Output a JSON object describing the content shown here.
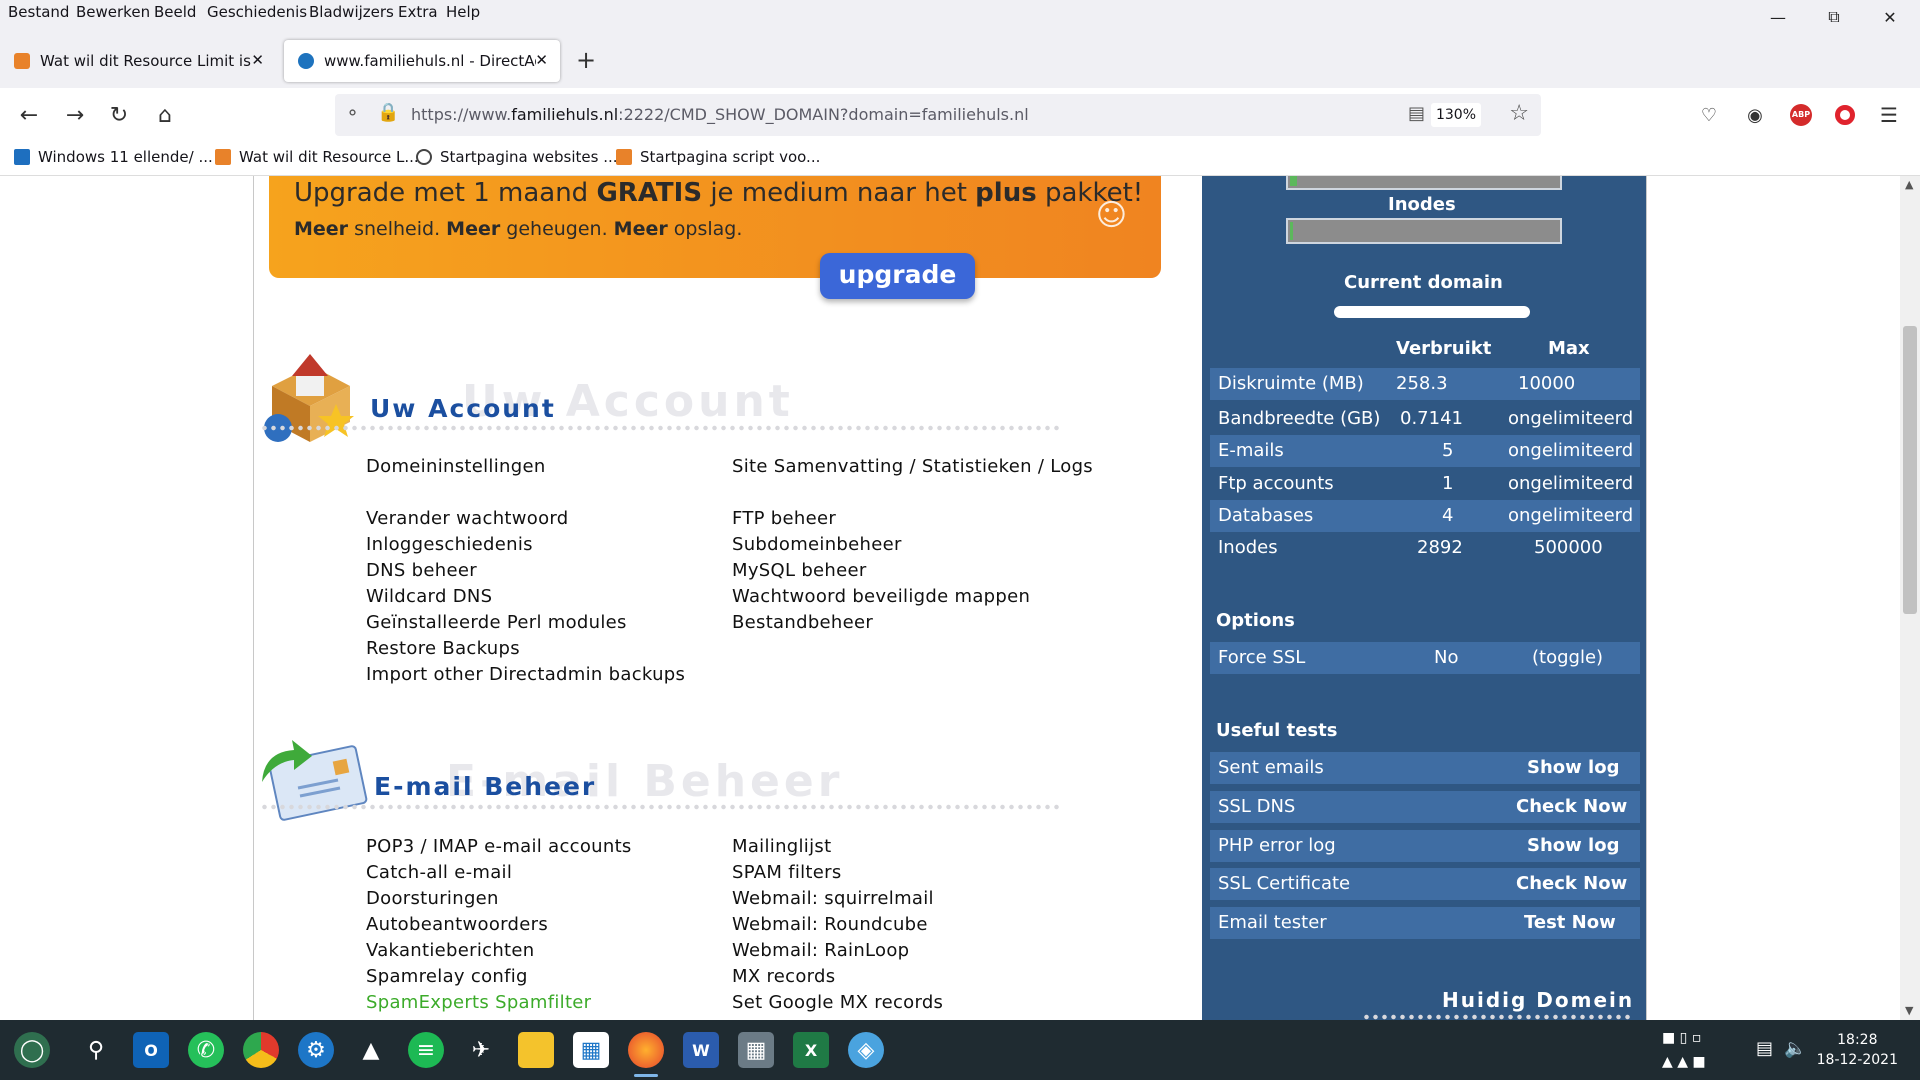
{
  "menu": [
    "Bestand",
    "Bewerken",
    "Beeld",
    "Geschiedenis",
    "Bladwijzers",
    "Extra",
    "Help"
  ],
  "tabs": [
    {
      "title": "Wat wil dit Resource Limit is Re",
      "active": false,
      "favicon_color": "#e8822a"
    },
    {
      "title": "www.familiehuls.nl - DirectAdm",
      "active": true,
      "favicon_color": "#1e73be"
    }
  ],
  "address": {
    "prefix": "https://www.",
    "host": "familiehuls.nl",
    "rest": ":2222/CMD_SHOW_DOMAIN?domain=familiehuls.nl",
    "zoom": "130%"
  },
  "bookmarks": [
    {
      "label": "Windows 11 ellende/ ...",
      "icon_color": "#1e6fbf"
    },
    {
      "label": "Wat wil dit Resource L...",
      "icon_color": "#e8822a"
    },
    {
      "label": "Startpagina websites ...",
      "icon_color": "#444444"
    },
    {
      "label": "Startpagina script voo...",
      "icon_color": "#e8822a"
    }
  ],
  "banner": {
    "line1_pre": "Upgrade met 1 maand ",
    "line1_bold1": "GRATIS",
    "line1_mid": " je medium naar het ",
    "line1_bold2": "plus",
    "line1_post": " pakket!",
    "line2_b1": "Meer",
    "line2_t1": " snelheid. ",
    "line2_b2": "Meer",
    "line2_t2": " geheugen. ",
    "line2_b3": "Meer",
    "line2_t3": " opslag.",
    "button": "upgrade"
  },
  "account": {
    "title": "Uw Account",
    "ghost": "Uw Account",
    "left": [
      "Domeininstellingen",
      "Verander wachtwoord",
      "Inloggeschiedenis",
      "DNS beheer",
      "Wildcard DNS",
      "Geïnstalleerde Perl modules",
      "Restore Backups",
      "Import other Directadmin backups"
    ],
    "right": [
      "Site Samenvatting / Statistieken / Logs",
      "FTP beheer",
      "Subdomeinbeheer",
      "MySQL beheer",
      "Wachtwoord beveiligde mappen",
      "Bestandbeheer"
    ]
  },
  "email": {
    "title": "E-mail Beheer",
    "ghost": "E-mail Beheer",
    "left": [
      "POP3 / IMAP e-mail accounts",
      "Catch-all e-mail",
      "Doorsturingen",
      "Autobeantwoorders",
      "Vakantieberichten",
      "Spamrelay config",
      "SpamExperts Spamfilter"
    ],
    "right": [
      "Mailinglijst",
      "SPAM filters",
      "Webmail: squirrelmail",
      "Webmail: Roundcube",
      "Webmail: RainLoop",
      "MX records",
      "Set Google MX records"
    ]
  },
  "side": {
    "inodes_label": "Inodes",
    "disk_usage_fraction": 0.026,
    "inodes_usage_fraction": 0.006,
    "current_domain": "Current domain",
    "head_used": "Verbruikt",
    "head_max": "Max",
    "stats": [
      {
        "label": "Diskruimte (MB)",
        "used": "258.3",
        "max": "10000"
      },
      {
        "label": "Bandbreedte (GB)",
        "used": "0.7141",
        "max": "ongelimiteerd"
      },
      {
        "label": "E-mails",
        "used": "5",
        "max": "ongelimiteerd"
      },
      {
        "label": "Ftp accounts",
        "used": "1",
        "max": "ongelimiteerd"
      },
      {
        "label": "Databases",
        "used": "4",
        "max": "ongelimiteerd"
      },
      {
        "label": "Inodes",
        "used": "2892",
        "max": "500000"
      }
    ],
    "options_title": "Options",
    "options": [
      {
        "label": "Force SSL",
        "value": "No",
        "action": "(toggle)"
      }
    ],
    "tests_title": "Useful tests",
    "tests": [
      {
        "label": "Sent emails",
        "action": "Show log"
      },
      {
        "label": "SSL DNS",
        "action": "Check Now"
      },
      {
        "label": "PHP error log",
        "action": "Show log"
      },
      {
        "label": "SSL Certificate",
        "action": "Check Now"
      },
      {
        "label": "Email tester",
        "action": "Test Now"
      }
    ],
    "footer": "Huidig Domein"
  },
  "taskbar": {
    "apps": [
      "globe-icon",
      "search-icon",
      "outlook-icon",
      "whatsapp-icon",
      "chrome-icon",
      "support-icon",
      "fox-icon",
      "spotify-icon",
      "plane-icon",
      "explorer-icon",
      "store-icon",
      "firefox-icon",
      "word-icon",
      "calculator-icon",
      "excel-icon",
      "paint-icon"
    ],
    "time": "18:28",
    "date": "18-12-2021"
  },
  "colors": {
    "side_bg": "#2f5783",
    "row_alt": "#3f6da3",
    "title_blue": "#1b4fa0",
    "banner_orange": "#f6a31d",
    "button_blue": "#3b67d8",
    "green_link": "#3cab2a"
  }
}
